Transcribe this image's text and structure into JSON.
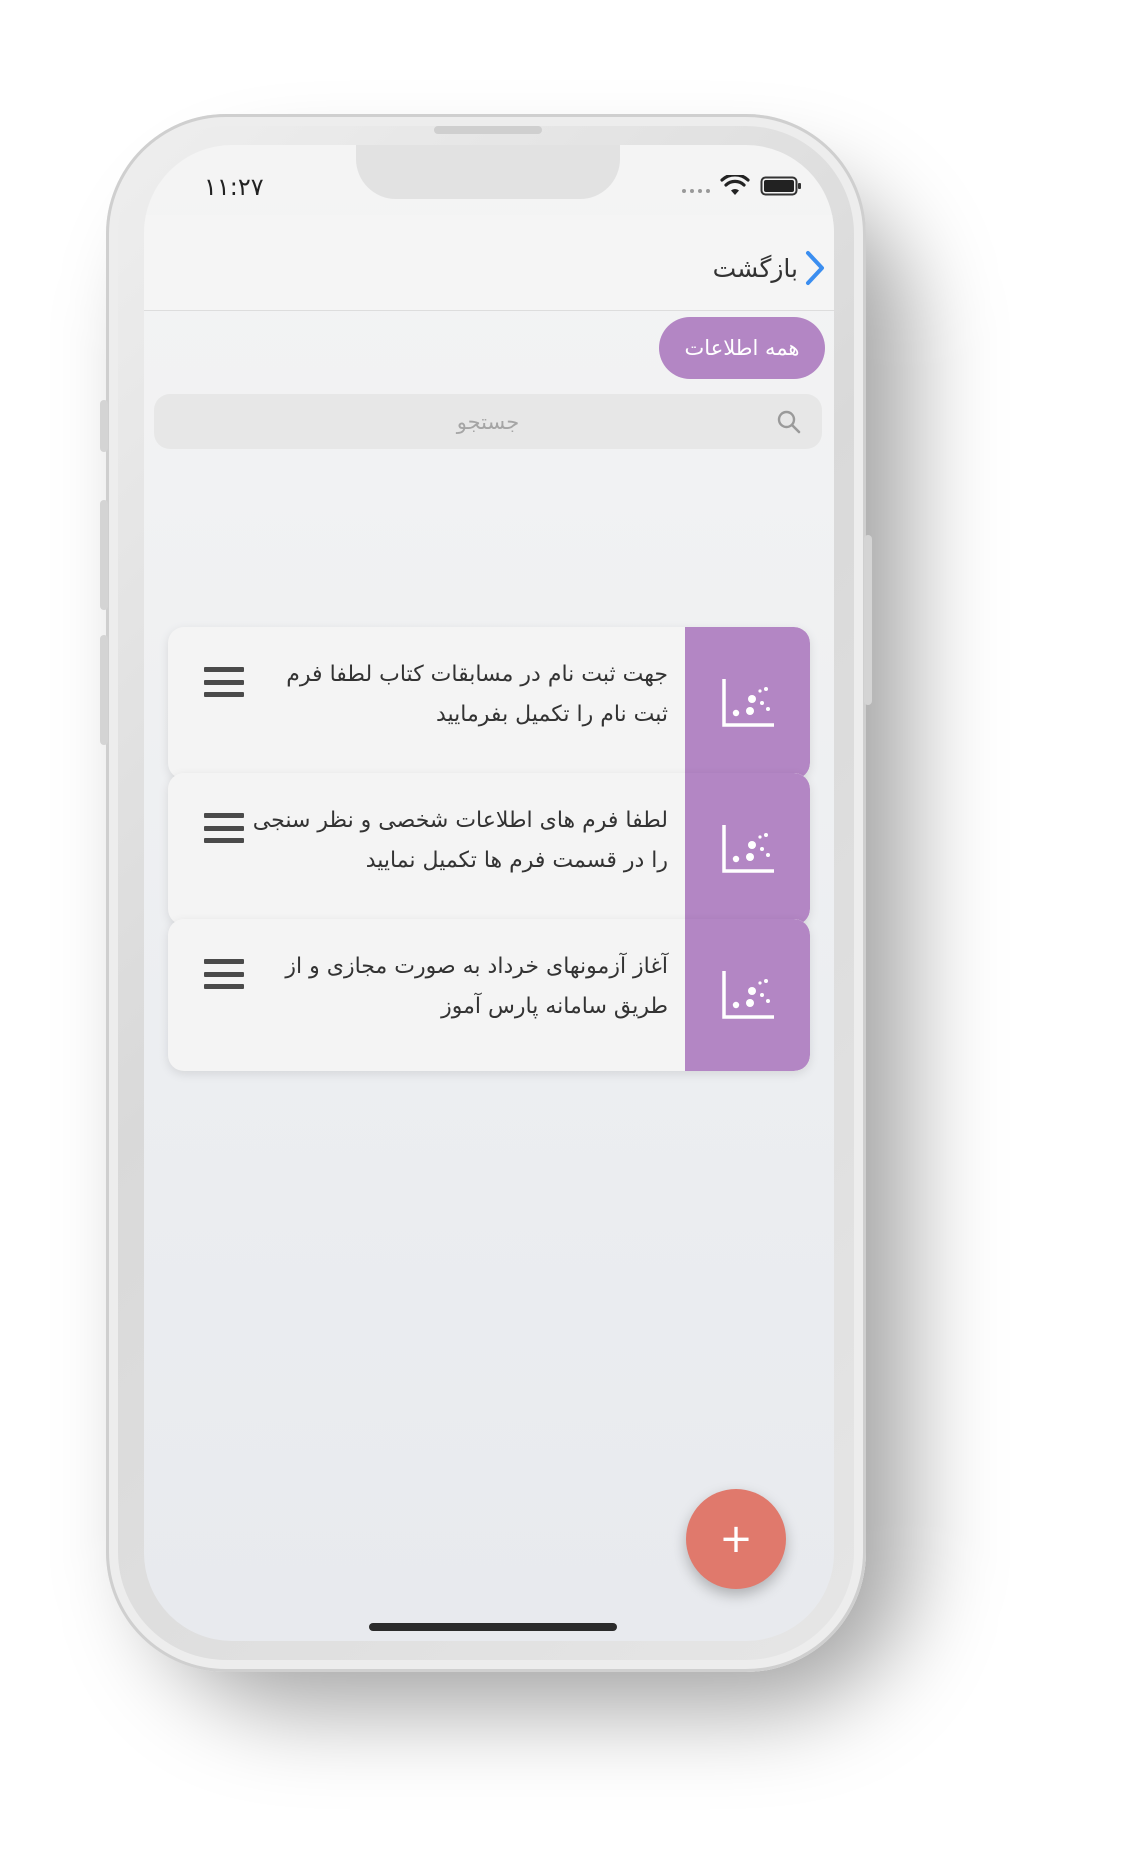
{
  "status_bar": {
    "time": "۱۱:۲۷",
    "icons": [
      "signal-dots-icon",
      "wifi-icon",
      "battery-icon"
    ]
  },
  "header": {
    "back_label": "بازگشت",
    "back_icon": "chevron-right-icon"
  },
  "filter": {
    "chip_label": "همه  اطلاعات"
  },
  "search": {
    "placeholder": "جستجو",
    "icon": "search-icon"
  },
  "list": {
    "items": [
      {
        "text": "جهت ثبت نام در مسابقات کتاب لطفا فرم ثبت نام را تکمیل بفرمایید",
        "icon": "chart-icon"
      },
      {
        "text": "لطفا فرم های اطلاعات شخصی و نظر سنجی را در قسمت فرم ها تکمیل نمایید",
        "icon": "chart-icon"
      },
      {
        "text": "آغاز آزمونهای خرداد به صورت مجازی و از طریق سامانه پارس آموز",
        "icon": "chart-icon"
      }
    ]
  },
  "fab": {
    "label": "+"
  },
  "colors": {
    "accent_purple": "#b386c4",
    "fab_red": "#e0796c",
    "back_blue": "#3b8ef0"
  }
}
